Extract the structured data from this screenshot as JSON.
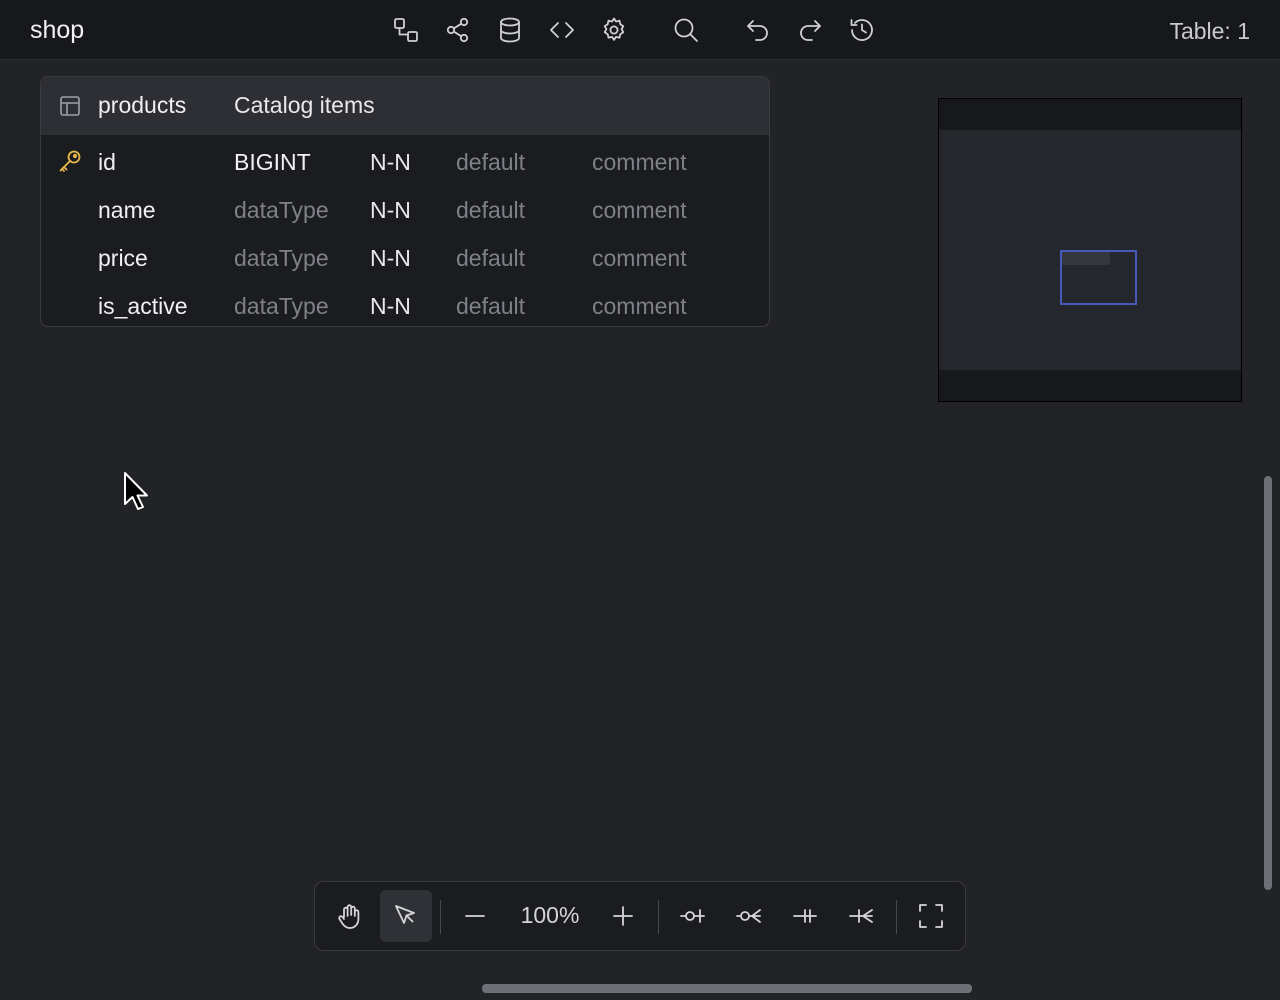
{
  "header": {
    "project_name": "shop",
    "table_count": "Table: 1",
    "icons": [
      "relationship-icon",
      "share-icon",
      "database-icon",
      "code-icon",
      "settings-icon",
      "search-icon",
      "undo-icon",
      "redo-icon",
      "history-icon"
    ]
  },
  "table": {
    "name": "products",
    "comment": "Catalog items",
    "columns": [
      {
        "name": "id",
        "type": "BIGINT",
        "nullable": "N-N",
        "default": "default",
        "comment": "comment",
        "primary_key": true
      },
      {
        "name": "name",
        "type": "dataType",
        "nullable": "N-N",
        "default": "default",
        "comment": "comment",
        "primary_key": false
      },
      {
        "name": "price",
        "type": "dataType",
        "nullable": "N-N",
        "default": "default",
        "comment": "comment",
        "primary_key": false
      },
      {
        "name": "is_active",
        "type": "dataType",
        "nullable": "N-N",
        "default": "default",
        "comment": "comment",
        "primary_key": false
      }
    ]
  },
  "bottom_toolbar": {
    "zoom": "100%",
    "active_tool": "select"
  },
  "colors": {
    "background": "#222327",
    "header": "#17181b",
    "key_icon": "#e8b84a",
    "minimap_viewport": "#4559b8"
  }
}
